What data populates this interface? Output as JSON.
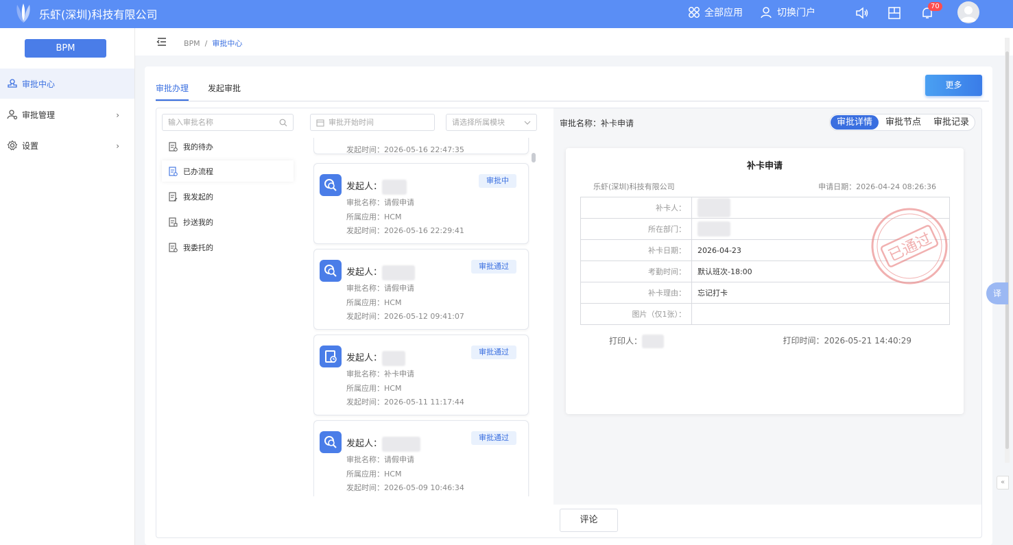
{
  "header": {
    "company": "乐虾(深圳)科技有限公司",
    "all_apps": "全部应用",
    "switch_portal": "切换门户",
    "notification_count": "70"
  },
  "sidebar": {
    "app_button": "BPM",
    "items": [
      {
        "label": "审批中心",
        "active": true
      },
      {
        "label": "审批管理"
      },
      {
        "label": "设置"
      }
    ]
  },
  "breadcrumb": {
    "root": "BPM",
    "sep": "/",
    "current": "审批中心"
  },
  "tabs": [
    {
      "label": "审批办理",
      "active": true
    },
    {
      "label": "发起审批"
    }
  ],
  "more_button": "更多",
  "filters": {
    "search_placeholder": "输入审批名称",
    "date_placeholder": "审批开始时间",
    "module_placeholder": "请选择所属模块"
  },
  "categories": [
    {
      "label": "我的待办"
    },
    {
      "label": "已办流程",
      "active": true
    },
    {
      "label": "我发起的"
    },
    {
      "label": "抄送我的"
    },
    {
      "label": "我委托的"
    }
  ],
  "partial_time": "发起时间：2026-05-16 22:47:35",
  "cards": [
    {
      "initiator": "发起人：",
      "status": "审批中",
      "name": "审批名称：请假申请",
      "app": "所属应用：HCM",
      "time": "发起时间：2026-05-16 22:29:41"
    },
    {
      "initiator": "发起人：",
      "status": "审批通过",
      "name": "审批名称：请假申请",
      "app": "所属应用：HCM",
      "time": "发起时间：2026-05-12 09:41:07"
    },
    {
      "initiator": "发起人：",
      "status": "审批通过",
      "name": "审批名称：补卡申请",
      "app": "所属应用：HCM",
      "time": "发起时间：2026-05-11 11:17:44"
    },
    {
      "initiator": "发起人：",
      "status": "审批通过",
      "name": "审批名称：请假申请",
      "app": "所属应用：HCM",
      "time": "发起时间：2026-05-09 10:46:34"
    }
  ],
  "detail": {
    "title": "审批名称：补卡申请",
    "segments": [
      "审批详情",
      "审批节点",
      "审批记录"
    ],
    "doc_title": "补卡申请",
    "company": "乐虾(深圳)科技有限公司",
    "apply_date": "申请日期：2026-04-24 08:26:36",
    "rows": [
      {
        "label": "补卡人：",
        "value": ""
      },
      {
        "label": "所在部门：",
        "value": ""
      },
      {
        "label": "补卡日期：",
        "value": "2026-04-23"
      },
      {
        "label": "考勤时间：",
        "value": "默认班次-18:00"
      },
      {
        "label": "补卡理由：",
        "value": "忘记打卡"
      },
      {
        "label": "图片（仅1张）：",
        "value": ""
      }
    ],
    "printer": "打印人：",
    "print_time": "打印时间：2026-05-21 14:40:29",
    "stamp_text": "已通过"
  },
  "comment_button": "评论",
  "translate_label": "译",
  "colors": {
    "primary": "#3a6fe0",
    "topbar": "#5a8ef5",
    "stamp": "#e87c7c"
  }
}
